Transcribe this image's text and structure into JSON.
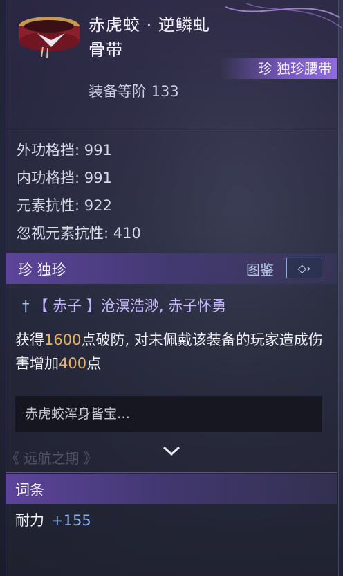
{
  "item": {
    "name_line1": "赤虎蛟 · 逆鳞虬",
    "name_line2": "骨带",
    "rarity_badge": "珍 独珍腰带",
    "equip_level": "装备等阶 133",
    "icon": "belt-item-icon"
  },
  "stats": [
    "外功格挡: 991",
    "内功格挡: 991",
    "元素抗性: 922",
    "忽视元素抗性: 410"
  ],
  "unique_section": {
    "label": "珍  独珍",
    "catalog_label": "图鉴",
    "catalog_button": "◇›",
    "effect_title": "【 赤子 】沧溟浩渺, 赤子怀勇",
    "effect_desc_1": "获得",
    "effect_value_1": "1600",
    "effect_desc_2": "点破防, 对未佩戴该装备的玩家造成伤害增加",
    "effect_value_2": "400",
    "effect_desc_3": "点",
    "lore_text": "赤虎蛟浑身皆宝…",
    "faded_title": "《 远航之期 》"
  },
  "affix_section": {
    "label": "词条",
    "rows": [
      {
        "name": "耐力",
        "value": "+155"
      }
    ]
  },
  "colors": {
    "highlight": "#e8b25a",
    "accent_purple": "#8f6ed8",
    "stat_value_blue": "#8fb0f0"
  }
}
